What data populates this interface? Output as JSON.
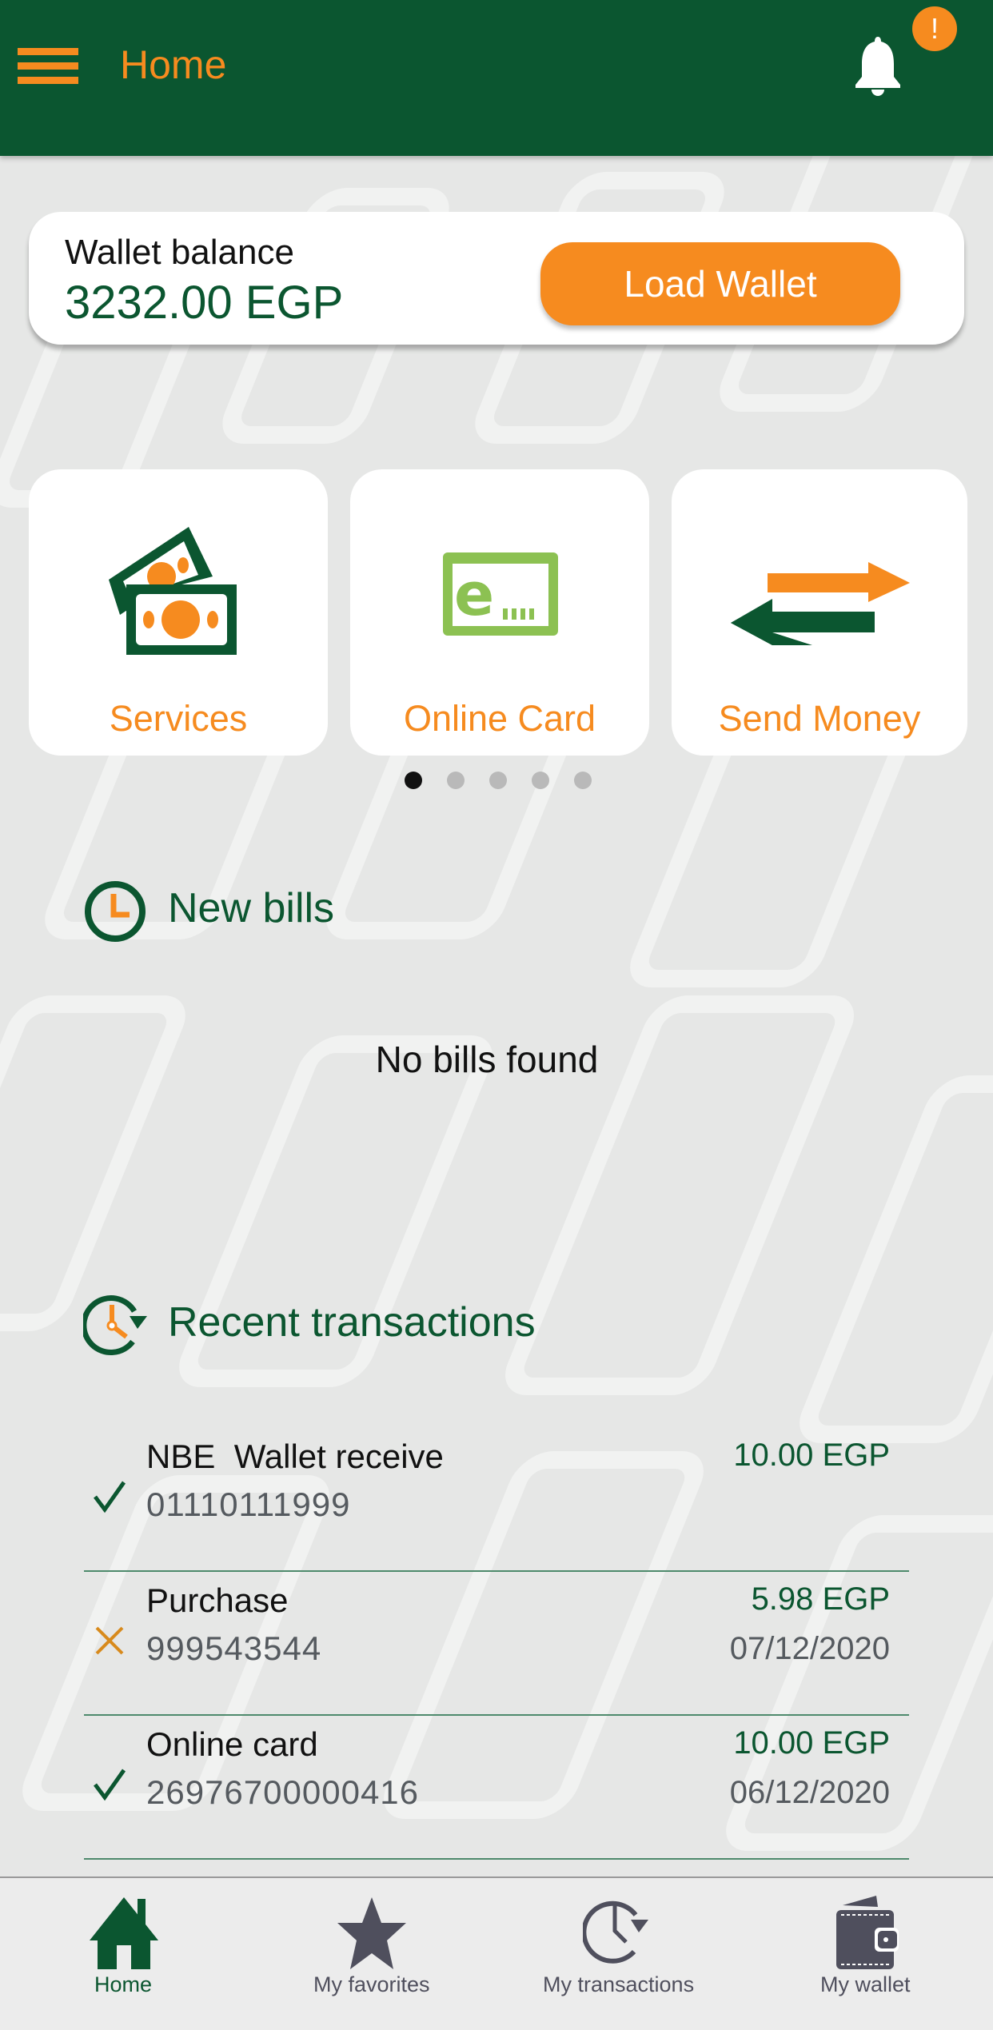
{
  "header": {
    "title": "Home",
    "menu_icon": "hamburger-menu-icon",
    "notification_icon": "bell-icon",
    "notification_badge": "!"
  },
  "wallet": {
    "label": "Wallet balance",
    "balance": "3232.00 EGP",
    "load_button": "Load Wallet"
  },
  "quick_actions": [
    {
      "label": "Services",
      "icon": "money-bills-icon"
    },
    {
      "label": "Online Card",
      "icon": "e-card-icon"
    },
    {
      "label": "Send Money",
      "icon": "transfer-arrows-icon"
    }
  ],
  "carousel": {
    "page_count": 5,
    "active_index": 0
  },
  "new_bills": {
    "title": "New bills",
    "icon": "clock-icon",
    "empty_message": "No bills found"
  },
  "recent_transactions": {
    "title": "Recent transactions",
    "icon": "history-clock-icon",
    "items": [
      {
        "name": "NBE  Wallet receive",
        "reference": "01110111999",
        "amount": "10.00 EGP",
        "date": "",
        "status": "success"
      },
      {
        "name": "Purchase",
        "reference": "999543544",
        "amount": "5.98 EGP",
        "date": "07/12/2020",
        "status": "failed"
      },
      {
        "name": "Online card",
        "reference": "26976700000416",
        "amount": "10.00 EGP",
        "date": "06/12/2020",
        "status": "success"
      }
    ]
  },
  "bottom_nav": [
    {
      "label": "Home",
      "icon": "home-icon",
      "active": true
    },
    {
      "label": "My favorites",
      "icon": "star-icon",
      "active": false
    },
    {
      "label": "My transactions",
      "icon": "history-clock-icon",
      "active": false
    },
    {
      "label": "My wallet",
      "icon": "wallet-icon",
      "active": false
    }
  ],
  "colors": {
    "primary_green": "#0b5630",
    "accent_orange": "#f68b1f",
    "light_green": "#8cc152",
    "background": "#e6e7e6"
  }
}
